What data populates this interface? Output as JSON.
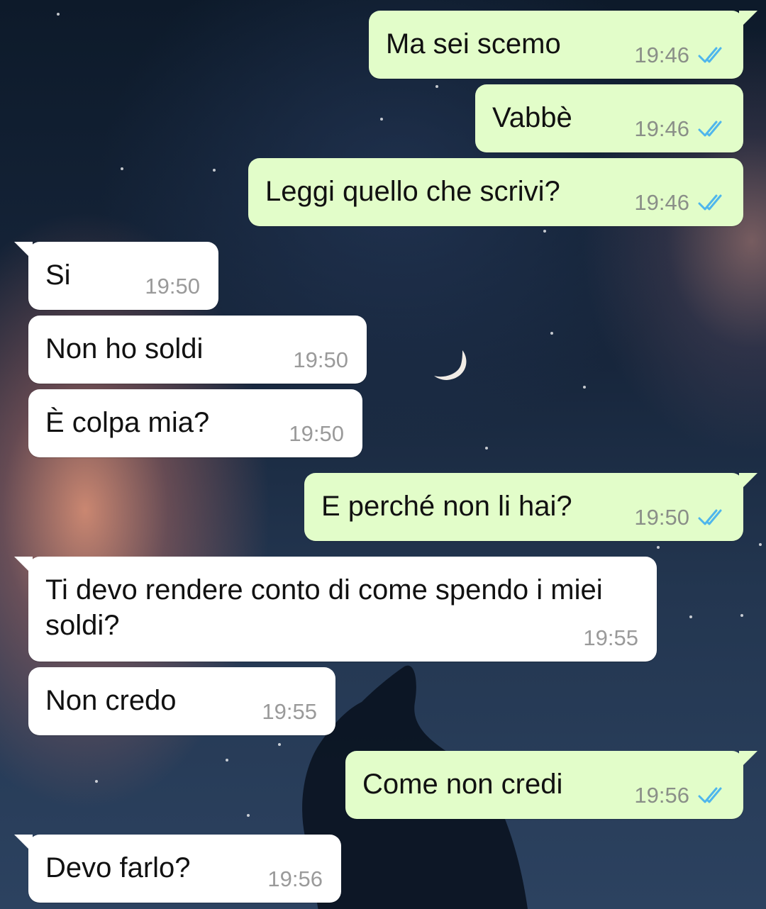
{
  "chat": {
    "messages": [
      {
        "direction": "outgoing",
        "text": "Ma sei scemo",
        "time": "19:46",
        "status_icon": "double-check-read-icon"
      },
      {
        "direction": "outgoing",
        "text": "Vabbè",
        "time": "19:46",
        "status_icon": "double-check-read-icon"
      },
      {
        "direction": "outgoing",
        "text": "Leggi quello che scrivi?",
        "time": "19:46",
        "status_icon": "double-check-read-icon"
      },
      {
        "direction": "incoming",
        "text": "Si",
        "time": "19:50"
      },
      {
        "direction": "incoming",
        "text": "Non ho soldi",
        "time": "19:50"
      },
      {
        "direction": "incoming",
        "text": "È colpa mia?",
        "time": "19:50"
      },
      {
        "direction": "outgoing",
        "text": "E perché non li hai?",
        "time": "19:50",
        "status_icon": "double-check-read-icon"
      },
      {
        "direction": "incoming",
        "text": "Ti devo rendere conto di come spendo i miei soldi?",
        "time": "19:55"
      },
      {
        "direction": "incoming",
        "text": "Non credo",
        "time": "19:55"
      },
      {
        "direction": "outgoing",
        "text": "Come non credi",
        "time": "19:56",
        "status_icon": "double-check-read-icon"
      },
      {
        "direction": "incoming",
        "text": "Devo farlo?",
        "time": "19:56"
      }
    ]
  },
  "colors": {
    "outgoing_bubble": "#e2fdc9",
    "incoming_bubble": "#ffffff",
    "read_ticks": "#4fb6ec",
    "timestamp": "#8a8f88"
  }
}
